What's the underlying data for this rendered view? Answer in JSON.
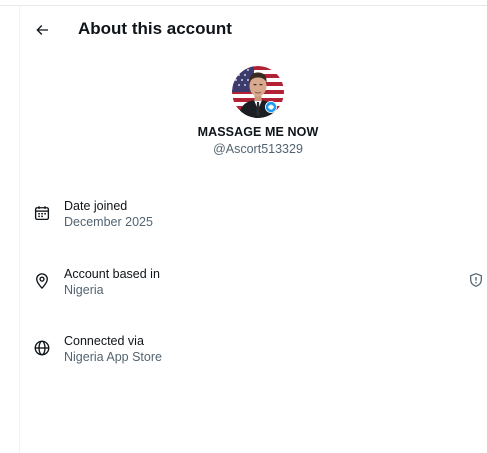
{
  "header": {
    "title": "About this account",
    "back_icon": "arrow-left-icon"
  },
  "profile": {
    "display_name": "MASSAGE ME NOW",
    "handle": "@Ascort513329",
    "badge_icon": "verified-badge-icon"
  },
  "details": [
    {
      "icon": "calendar-icon",
      "label": "Date joined",
      "value": "December 2025"
    },
    {
      "icon": "location-pin-icon",
      "label": "Account based in",
      "value": "Nigeria",
      "trailing_icon": "shield-alert-icon"
    },
    {
      "icon": "globe-icon",
      "label": "Connected via",
      "value": "Nigeria App Store"
    }
  ],
  "colors": {
    "text_primary": "#0f1419",
    "text_secondary": "#536471",
    "badge_blue": "#1d9bf0",
    "divider": "#eff3f4"
  }
}
